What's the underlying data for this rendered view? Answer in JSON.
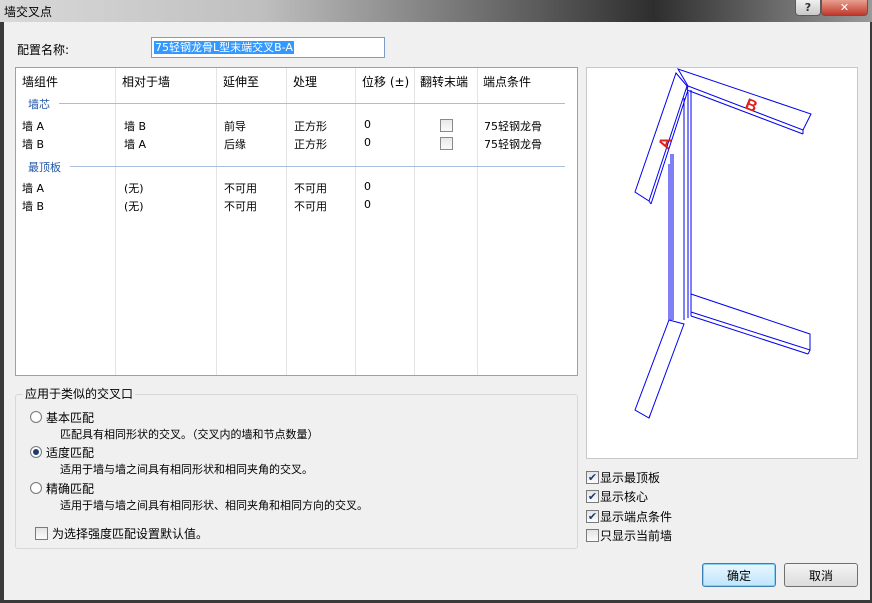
{
  "window": {
    "title": "墙交叉点"
  },
  "titlebar_buttons": {
    "help": "?",
    "close": "✕"
  },
  "config": {
    "label": "配置名称:",
    "value": "75轻钢龙骨L型末端交叉B-A"
  },
  "grid": {
    "headers": [
      "墙组件",
      "相对于墙",
      "延伸至",
      "处理",
      "位移 (±)",
      "翻转末端",
      "端点条件"
    ],
    "sections": [
      {
        "name": "墙芯",
        "rows": [
          {
            "component": "墙 A",
            "relative": "墙 B",
            "extend": "前导",
            "treatment": "正方形",
            "offset": "0",
            "flip": false,
            "endcap": "75轻钢龙骨"
          },
          {
            "component": "墙 B",
            "relative": "墙 A",
            "extend": "后缘",
            "treatment": "正方形",
            "offset": "0",
            "flip": false,
            "endcap": "75轻钢龙骨"
          }
        ]
      },
      {
        "name": "最顶板",
        "rows": [
          {
            "component": "墙 A",
            "relative": "(无)",
            "extend": "不可用",
            "treatment": "不可用",
            "offset": "0"
          },
          {
            "component": "墙 B",
            "relative": "(无)",
            "extend": "不可用",
            "treatment": "不可用",
            "offset": "0"
          }
        ]
      }
    ]
  },
  "apply": {
    "title": "应用于类似的交叉口",
    "options": [
      {
        "label": "基本匹配",
        "desc": "匹配具有相同形状的交叉。（交叉内的墙和节点数量）",
        "selected": false
      },
      {
        "label": "适度匹配",
        "desc": "适用于墙与墙之间具有相同形状和相同夹角的交叉。",
        "selected": true
      },
      {
        "label": "精确匹配",
        "desc": "适用于墙与墙之间具有相同形状、相同夹角和相同方向的交叉。",
        "selected": false
      }
    ],
    "default_checkbox": {
      "label": "为选择强度匹配设置默认值。",
      "checked": false
    }
  },
  "preview": {
    "label_a": "A",
    "label_b": "B",
    "line_color": "#0000ee",
    "label_color": "#e02020"
  },
  "display": {
    "show_top_plate": {
      "label": "显示最顶板",
      "checked": true
    },
    "show_core": {
      "label": "显示核心",
      "checked": true
    },
    "show_endcap": {
      "label": "显示端点条件",
      "checked": true
    },
    "show_current_only": {
      "label": "只显示当前墙",
      "checked": false
    }
  },
  "buttons": {
    "ok": "确定",
    "cancel": "取消"
  }
}
